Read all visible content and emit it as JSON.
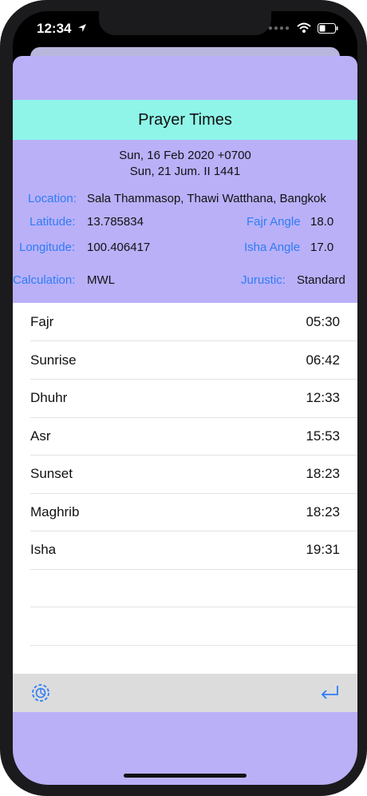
{
  "status": {
    "time": "12:34"
  },
  "header": {
    "title": "Prayer Times"
  },
  "dates": {
    "gregorian": "Sun, 16 Feb 2020 +0700",
    "hijri": "Sun, 21 Jum. II 1441"
  },
  "info": {
    "location_label": "Location:",
    "location_value": "Sala Thammasop, Thawi Watthana, Bangkok",
    "latitude_label": "Latitude:",
    "latitude_value": "13.785834",
    "fajr_angle_label": "Fajr Angle",
    "fajr_angle_value": "18.0",
    "longitude_label": "Longitude:",
    "longitude_value": "100.406417",
    "isha_angle_label": "Isha Angle",
    "isha_angle_value": "17.0",
    "calculation_label": "Calculation:",
    "calculation_value": "MWL",
    "juristic_label": "Jurustic:",
    "juristic_value": "Standard"
  },
  "prayers": [
    {
      "name": "Fajr",
      "time": "05:30"
    },
    {
      "name": "Sunrise",
      "time": "06:42"
    },
    {
      "name": "Dhuhr",
      "time": "12:33"
    },
    {
      "name": "Asr",
      "time": "15:53"
    },
    {
      "name": "Sunset",
      "time": "18:23"
    },
    {
      "name": "Maghrib",
      "time": "18:23"
    },
    {
      "name": "Isha",
      "time": "19:31"
    }
  ],
  "toolbar": {
    "left_icon": "settings-icon",
    "right_icon": "return-icon"
  },
  "colors": {
    "accent": "#2f7cf6",
    "header": "#8ff5e8",
    "background": "#b9b0f8"
  }
}
